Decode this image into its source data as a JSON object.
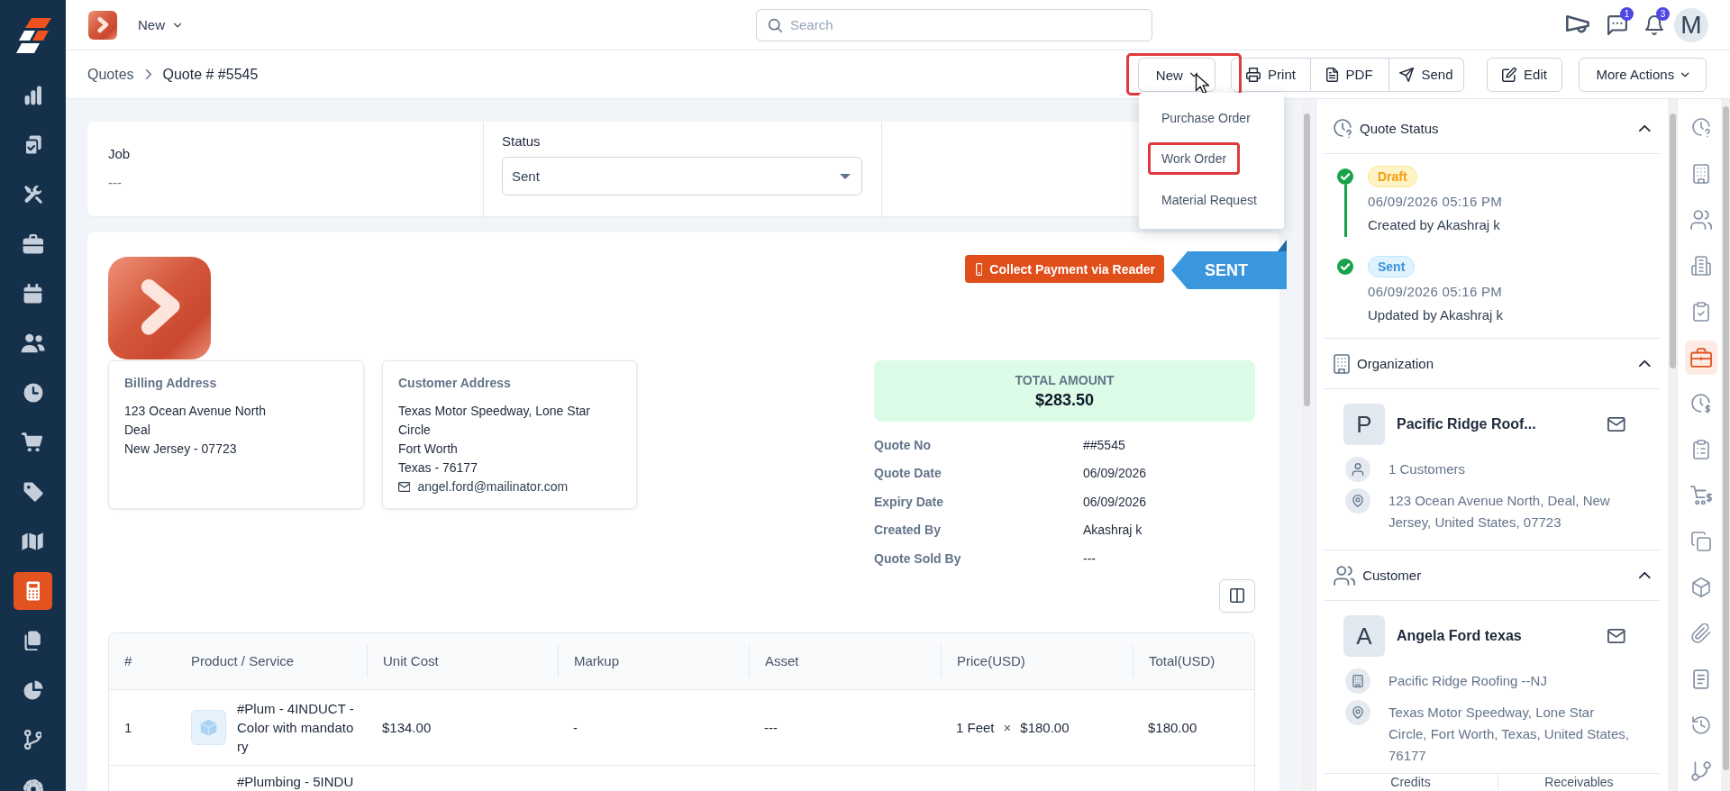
{
  "sidebar": {
    "items": [
      {
        "selected": false
      },
      {
        "selected": false
      },
      {
        "selected": false
      },
      {
        "selected": false
      },
      {
        "selected": false
      },
      {
        "selected": false
      },
      {
        "selected": false
      },
      {
        "selected": false
      },
      {
        "selected": false
      },
      {
        "selected": false
      },
      {
        "selected": true
      },
      {
        "selected": false
      },
      {
        "selected": false
      },
      {
        "selected": false
      },
      {
        "selected": false
      }
    ]
  },
  "top_bar": {
    "menu": "New",
    "search": {
      "placeholder": "Search"
    },
    "messages_badge": "1",
    "notifications_badge": "3",
    "avatar": "M"
  },
  "breadcrumb": [
    {
      "label": "Quotes"
    },
    {
      "label": "Quote # #5545"
    }
  ],
  "toolbar": {
    "new_button": {
      "label": "New",
      "highlighted": true
    },
    "buttons": [
      {
        "label": "Print"
      },
      {
        "label": "PDF"
      },
      {
        "label": "Send"
      }
    ],
    "edit": "Edit",
    "more_actions": "More Actions"
  },
  "new_menu": {
    "items": [
      {
        "label": "Purchase Order",
        "highlighted": false
      },
      {
        "label": "Work Order",
        "highlighted": true
      },
      {
        "label": "Material Request",
        "highlighted": false
      }
    ]
  },
  "summary": {
    "job": {
      "label": "Job",
      "value": "---"
    },
    "status": {
      "label": "Status",
      "value": "Sent"
    }
  },
  "quote": {
    "collect_payment": "Collect Payment via Reader",
    "ribbon": "SENT",
    "billing_address": {
      "title": "Billing Address",
      "lines": [
        "123 Ocean Avenue North",
        "Deal",
        "New Jersey - 07723"
      ]
    },
    "customer_address": {
      "title": "Customer Address",
      "lines": [
        "Texas Motor Speedway, Lone Star Circle",
        "Fort Worth",
        "Texas - 76177"
      ],
      "email": "angel.ford@mailinator.com"
    },
    "total": {
      "label": "TOTAL AMOUNT",
      "value": "$283.50"
    },
    "details": [
      {
        "label": "Quote No",
        "value": "##5545"
      },
      {
        "label": "Quote Date",
        "value": "06/09/2026"
      },
      {
        "label": "Expiry Date",
        "value": "06/09/2026"
      },
      {
        "label": "Created By",
        "value": "Akashraj k"
      },
      {
        "label": "Quote Sold By",
        "value": "---"
      }
    ]
  },
  "table": {
    "columns": [
      "#",
      "Product / Service",
      "Unit Cost",
      "Markup",
      "Asset",
      "Price(USD)",
      "Total(USD)"
    ],
    "rows": [
      {
        "number": "1",
        "thumbnail": true,
        "product": "#Plum - 4INDUCT - Color with mandatory",
        "unit_cost": "$134.00",
        "markup": "-",
        "asset": "---",
        "quantity": "1 Feet",
        "times": "×",
        "price": "$180.00",
        "total": "$180.00"
      },
      {
        "product": "#Plumbing - 5INDU"
      }
    ]
  },
  "side_panel": {
    "quote_status": {
      "title": "Quote Status",
      "expanded": true,
      "events": [
        {
          "status": "Draft",
          "kind": "draft",
          "date": "06/09/2026 05:16 PM",
          "note": "Created by Akashraj k",
          "done": true
        },
        {
          "status": "Sent",
          "kind": "sent",
          "date": "06/09/2026 05:16 PM",
          "note": "Updated by Akashraj k",
          "done": true
        }
      ]
    },
    "organization": {
      "title": "Organization",
      "expanded": true,
      "initial": "P",
      "name": "Pacific Ridge Roof...",
      "details": [
        {
          "kind": "customers",
          "text": "1 Customers"
        },
        {
          "kind": "address",
          "text": "123 Ocean Avenue North, Deal, New Jersey, United States, 07723"
        }
      ]
    },
    "customer": {
      "title": "Customer",
      "expanded": true,
      "initial": "A",
      "name": "Angela Ford texas",
      "details": [
        {
          "kind": "organization",
          "text": "Pacific Ridge Roofing --NJ"
        },
        {
          "kind": "address",
          "text": "Texas Motor Speedway, Lone Star Circle, Fort Worth, Texas, United States, 76177"
        }
      ]
    },
    "tabs": [
      {
        "label": "Credits"
      },
      {
        "label": "Receivables"
      }
    ]
  },
  "rail": {
    "items": [
      {
        "selected": false
      },
      {
        "selected": false
      },
      {
        "selected": false
      },
      {
        "selected": false
      },
      {
        "selected": false
      },
      {
        "selected": true
      },
      {
        "selected": false
      },
      {
        "selected": false
      },
      {
        "selected": false
      },
      {
        "selected": false
      },
      {
        "selected": false
      },
      {
        "selected": false
      },
      {
        "selected": false
      },
      {
        "selected": false
      },
      {
        "selected": false
      }
    ]
  }
}
